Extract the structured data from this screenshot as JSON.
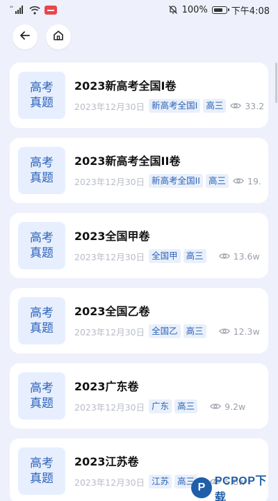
{
  "status_bar": {
    "signal_label": "⁴⁶",
    "battery": "100%",
    "time": "下午4:08"
  },
  "nav": {
    "back_icon": "arrow-left-icon",
    "home_icon": "home-icon"
  },
  "thumb_text": "高考\n真题",
  "items": [
    {
      "title": "2023新高考全国I卷",
      "date": "2023年12月30日",
      "tags": [
        "新高考全国I",
        "高三"
      ],
      "views": "33.2"
    },
    {
      "title": "2023新高考全国II卷",
      "date": "2023年12月30日",
      "tags": [
        "新高考全国II",
        "高三"
      ],
      "views": "19."
    },
    {
      "title": "2023全国甲卷",
      "date": "2023年12月30日",
      "tags": [
        "全国甲",
        "高三"
      ],
      "views": "13.6w"
    },
    {
      "title": "2023全国乙卷",
      "date": "2023年12月30日",
      "tags": [
        "全国乙",
        "高三"
      ],
      "views": "12.3w"
    },
    {
      "title": "2023广东卷",
      "date": "2023年12月30日",
      "tags": [
        "广东",
        "高三"
      ],
      "views": "9.2w"
    },
    {
      "title": "2023江苏卷",
      "date": "2023年12月30日",
      "tags": [
        "江苏",
        "高三"
      ],
      "views": "5.6w"
    }
  ],
  "watermark": {
    "logo_letter": "P",
    "text": "PCPOP下载"
  },
  "colors": {
    "background": "#eef0fb",
    "accent": "#2e63b8",
    "tag_bg": "#e9f0fb",
    "thumb_bg": "#e7efff"
  }
}
